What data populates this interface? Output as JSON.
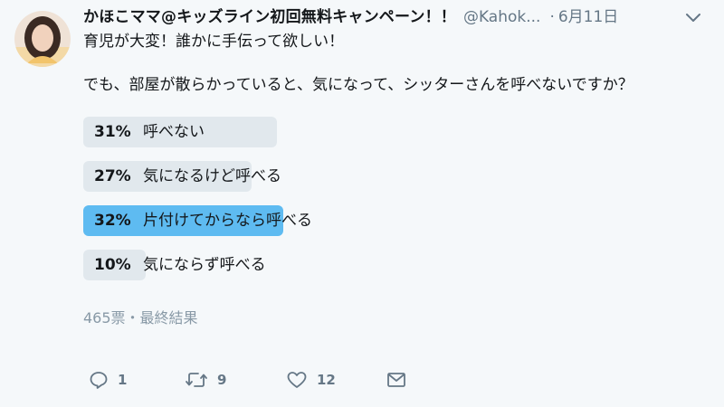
{
  "tweet": {
    "display_name": "かほこママ@キッズライン初回無料キャンペーン！！",
    "handle": "@Kahok...",
    "dot": "·",
    "date": "6月11日",
    "text_line1": "育児が大変！誰かに手伝って欲しい！",
    "text_line2": "でも、部屋が散らかっていると、気になって、シッターさんを呼べないですか？"
  },
  "poll": {
    "options": [
      {
        "percent_label": "31%",
        "label": "呼べない",
        "percent": 31,
        "winner": false
      },
      {
        "percent_label": "27%",
        "label": "気になるけど呼べる",
        "percent": 27,
        "winner": false
      },
      {
        "percent_label": "32%",
        "label": "片付けてからなら呼べる",
        "percent": 32,
        "winner": true
      },
      {
        "percent_label": "10%",
        "label": "気にならず呼べる",
        "percent": 10,
        "winner": false
      }
    ],
    "meta": "465票・最終結果"
  },
  "actions": {
    "reply_count": "1",
    "retweet_count": "9",
    "like_count": "12"
  },
  "colors": {
    "background": "#f5f8fa",
    "bar": "#e1e8ed",
    "winner_bar": "#5ebbf1",
    "secondary_text": "#657786"
  },
  "icons": {
    "avatar": "avatar",
    "caret": "chevron-down-icon",
    "reply": "reply-icon",
    "retweet": "retweet-icon",
    "like": "heart-icon",
    "message": "envelope-icon"
  }
}
